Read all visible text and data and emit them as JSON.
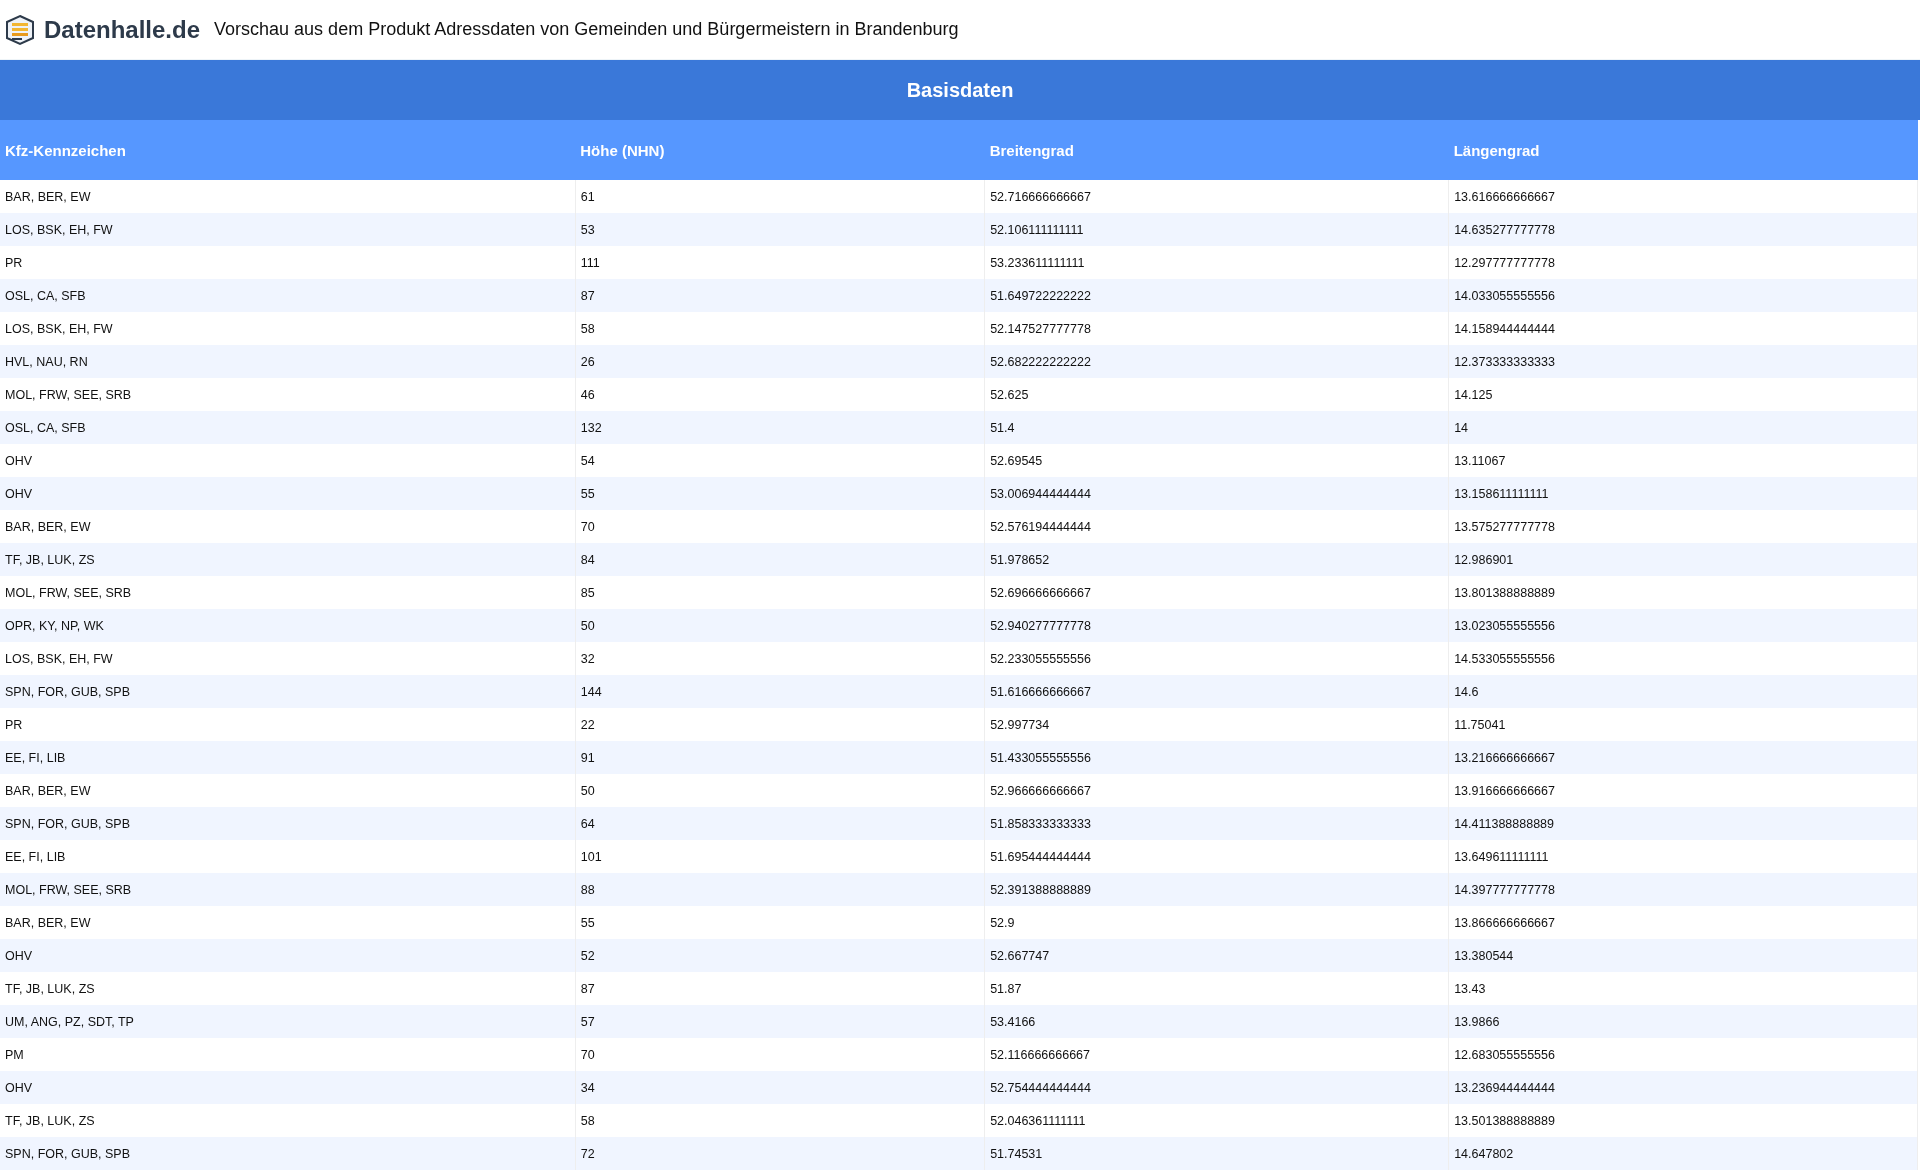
{
  "header": {
    "logo_text": "Datenhalle.de",
    "title": "Vorschau aus dem Produkt Adressdaten von Gemeinden und Bürgermeistern in Brandenburg"
  },
  "table": {
    "caption": "Basisdaten",
    "columns": [
      "Kfz-Kennzeichen",
      "Höhe (NHN)",
      "Breitengrad",
      "Längengrad"
    ],
    "rows": [
      [
        "BAR, BER, EW",
        "61",
        "52.716666666667",
        "13.616666666667"
      ],
      [
        "LOS, BSK, EH, FW",
        "53",
        "52.106111111111",
        "14.635277777778"
      ],
      [
        "PR",
        "111",
        "53.233611111111",
        "12.297777777778"
      ],
      [
        "OSL, CA, SFB",
        "87",
        "51.649722222222",
        "14.033055555556"
      ],
      [
        "LOS, BSK, EH, FW",
        "58",
        "52.147527777778",
        "14.158944444444"
      ],
      [
        "HVL, NAU, RN",
        "26",
        "52.682222222222",
        "12.373333333333"
      ],
      [
        "MOL, FRW, SEE, SRB",
        "46",
        "52.625",
        "14.125"
      ],
      [
        "OSL, CA, SFB",
        "132",
        "51.4",
        "14"
      ],
      [
        "OHV",
        "54",
        "52.69545",
        "13.11067"
      ],
      [
        "OHV",
        "55",
        "53.006944444444",
        "13.158611111111"
      ],
      [
        "BAR, BER, EW",
        "70",
        "52.576194444444",
        "13.575277777778"
      ],
      [
        "TF, JB, LUK, ZS",
        "84",
        "51.978652",
        "12.986901"
      ],
      [
        "MOL, FRW, SEE, SRB",
        "85",
        "52.696666666667",
        "13.801388888889"
      ],
      [
        "OPR, KY, NP, WK",
        "50",
        "52.940277777778",
        "13.023055555556"
      ],
      [
        "LOS, BSK, EH, FW",
        "32",
        "52.233055555556",
        "14.533055555556"
      ],
      [
        "SPN, FOR, GUB, SPB",
        "144",
        "51.616666666667",
        "14.6"
      ],
      [
        "PR",
        "22",
        "52.997734",
        "11.75041"
      ],
      [
        "EE, FI, LIB",
        "91",
        "51.433055555556",
        "13.216666666667"
      ],
      [
        "BAR, BER, EW",
        "50",
        "52.966666666667",
        "13.916666666667"
      ],
      [
        "SPN, FOR, GUB, SPB",
        "64",
        "51.858333333333",
        "14.411388888889"
      ],
      [
        "EE, FI, LIB",
        "101",
        "51.695444444444",
        "13.649611111111"
      ],
      [
        "MOL, FRW, SEE, SRB",
        "88",
        "52.391388888889",
        "14.397777777778"
      ],
      [
        "BAR, BER, EW",
        "55",
        "52.9",
        "13.866666666667"
      ],
      [
        "OHV",
        "52",
        "52.667747",
        "13.380544"
      ],
      [
        "TF, JB, LUK, ZS",
        "87",
        "51.87",
        "13.43"
      ],
      [
        "UM, ANG, PZ, SDT, TP",
        "57",
        "53.4166",
        "13.9866"
      ],
      [
        "PM",
        "70",
        "52.116666666667",
        "12.683055555556"
      ],
      [
        "OHV",
        "34",
        "52.754444444444",
        "13.236944444444"
      ],
      [
        "TF, JB, LUK, ZS",
        "58",
        "52.046361111111",
        "13.501388888889"
      ],
      [
        "SPN, FOR, GUB, SPB",
        "72",
        "51.74531",
        "14.647802"
      ]
    ]
  }
}
